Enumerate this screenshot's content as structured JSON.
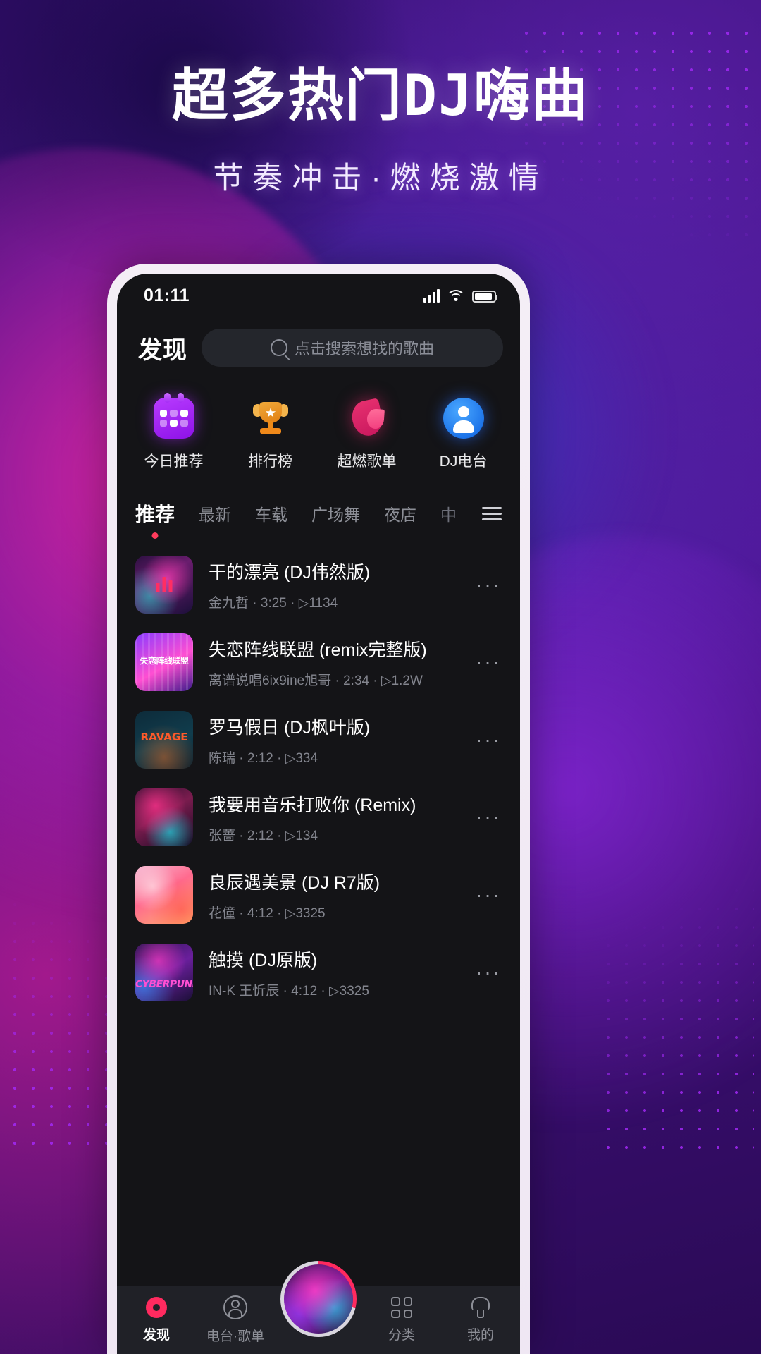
{
  "promo": {
    "title": "超多热门DJ嗨曲",
    "subtitle": "节奏冲击·燃烧激情"
  },
  "status_bar": {
    "time": "01:11",
    "signal_icon": "signal-bars-icon",
    "wifi_icon": "wifi-icon",
    "battery_icon": "battery-icon"
  },
  "header": {
    "title": "发现",
    "search_placeholder": "点击搜索想找的歌曲",
    "search_icon": "search-icon"
  },
  "categories": [
    {
      "label": "今日推荐",
      "icon": "calendar-icon"
    },
    {
      "label": "排行榜",
      "icon": "trophy-icon"
    },
    {
      "label": "超燃歌单",
      "icon": "flame-icon"
    },
    {
      "label": "DJ电台",
      "icon": "radio-person-icon"
    }
  ],
  "tabs": {
    "items": [
      {
        "label": "推荐",
        "active": true
      },
      {
        "label": "最新",
        "active": false
      },
      {
        "label": "车载",
        "active": false
      },
      {
        "label": "广场舞",
        "active": false
      },
      {
        "label": "夜店",
        "active": false
      },
      {
        "label": "中",
        "active": false
      }
    ],
    "menu_icon": "hamburger-menu-icon"
  },
  "songs": [
    {
      "title": "干的漂亮 (DJ伟然版)",
      "subtitle": "金九哲 · 3:25 · ▷1134",
      "artist": "金九哲",
      "duration": "3:25",
      "plays": "1134",
      "playing": true,
      "cover_text": ""
    },
    {
      "title": "失恋阵线联盟 (remix完整版)",
      "subtitle": "离谱说唱6ix9ine旭哥 · 2:34 · ▷1.2W",
      "artist": "离谱说唱6ix9ine旭哥",
      "duration": "2:34",
      "plays": "1.2W",
      "playing": false,
      "cover_text": "失恋阵线联盟"
    },
    {
      "title": "罗马假日 (DJ枫叶版)",
      "subtitle": "陈瑞 · 2:12 · ▷334",
      "artist": "陈瑞",
      "duration": "2:12",
      "plays": "334",
      "playing": false,
      "cover_text": "RAVAGE"
    },
    {
      "title": "我要用音乐打败你 (Remix)",
      "subtitle": "张蔷 · 2:12 · ▷134",
      "artist": "张蔷",
      "duration": "2:12",
      "plays": "134",
      "playing": false,
      "cover_text": ""
    },
    {
      "title": "良辰遇美景 (DJ R7版)",
      "subtitle": "花僮 · 4:12 · ▷3325",
      "artist": "花僮",
      "duration": "4:12",
      "plays": "3325",
      "playing": false,
      "cover_text": ""
    },
    {
      "title": "触摸 (DJ原版)",
      "subtitle": "IN-K 王忻辰 · 4:12 · ▷3325",
      "artist": "IN-K 王忻辰",
      "duration": "4:12",
      "plays": "3325",
      "playing": false,
      "cover_text": "CYBERPUNK"
    }
  ],
  "row_more_label": "···",
  "bottom_nav": [
    {
      "label": "发现",
      "icon": "disc-icon",
      "active": true
    },
    {
      "label": "电台·歌单",
      "icon": "user-circle-icon",
      "active": false
    },
    {
      "label": "分类",
      "icon": "grid-icon",
      "active": false
    },
    {
      "label": "我的",
      "icon": "person-icon",
      "active": false
    }
  ],
  "now_playing_avatar": "now-playing-avatar",
  "colors": {
    "accent_pink": "#ff2a5f",
    "tab_dot": "#ff3b5c",
    "screen_bg": "#141417",
    "nav_bg": "#202127",
    "muted_text": "#8d8f97"
  }
}
